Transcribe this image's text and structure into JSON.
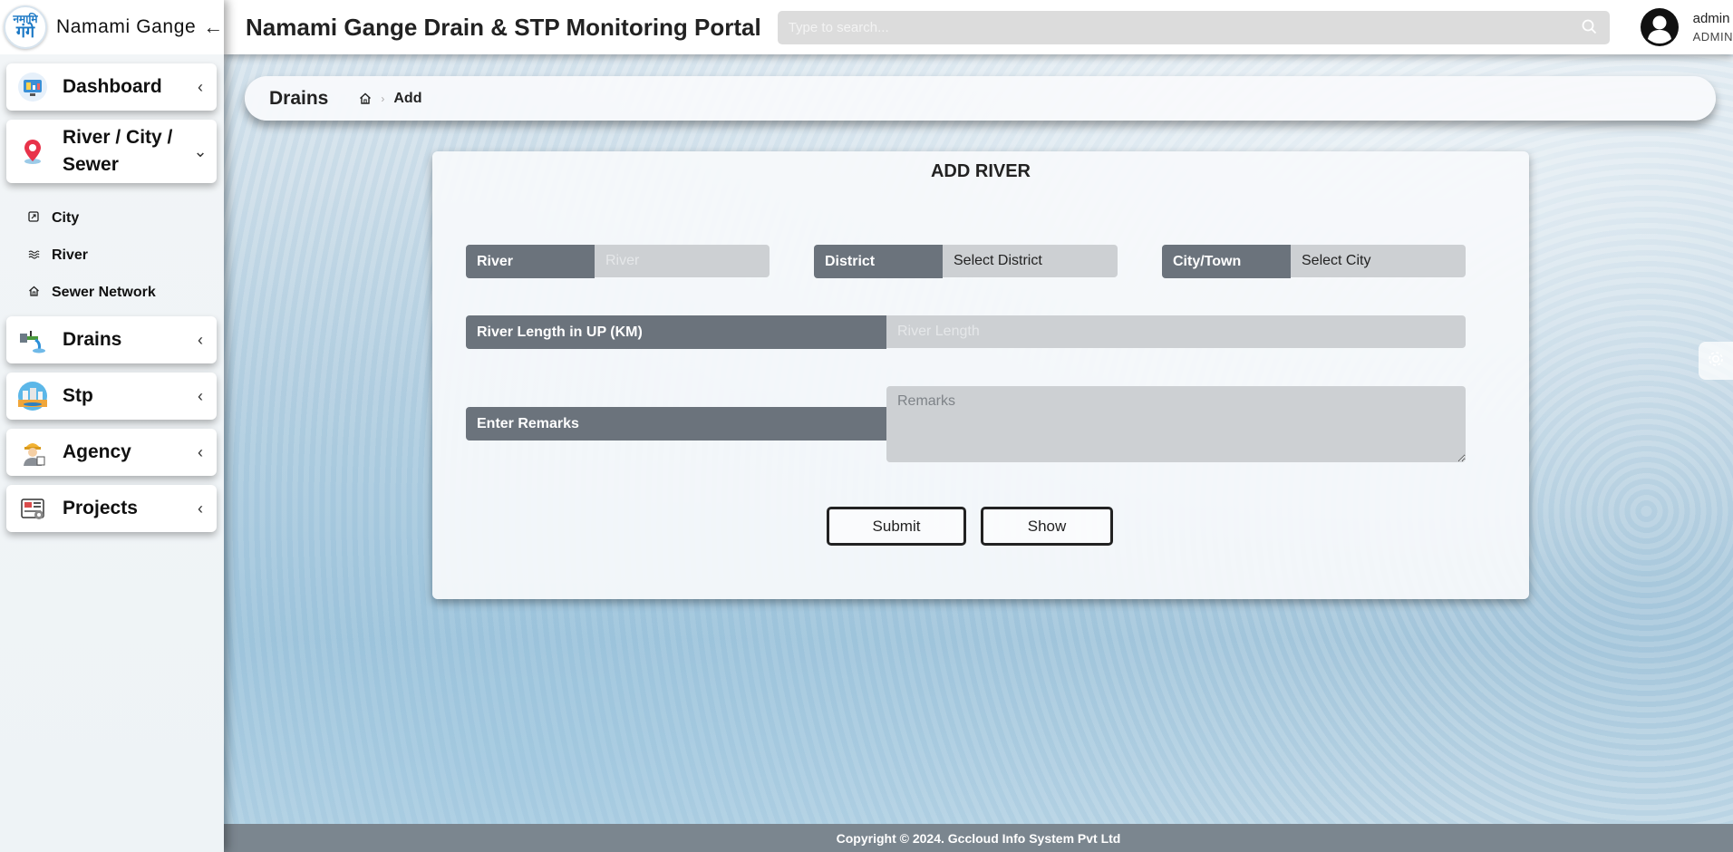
{
  "brand": {
    "logo_line1": "नमामि",
    "logo_line2": "गंगे",
    "name": "Namami Gange",
    "back_icon": "arrow-left-icon"
  },
  "sidebar": {
    "menus": [
      {
        "label": "Dashboard",
        "icon": "dashboard-icon"
      },
      {
        "label": "River / City / Sewer",
        "icon": "location-pin-icon"
      },
      {
        "label": "Drains",
        "icon": "drain-icon"
      },
      {
        "label": "Stp",
        "icon": "stp-icon"
      },
      {
        "label": "Agency",
        "icon": "agency-icon"
      },
      {
        "label": "Projects",
        "icon": "projects-icon"
      }
    ],
    "submenu": [
      {
        "label": "City",
        "icon": "city-icon"
      },
      {
        "label": "River",
        "icon": "waves-icon"
      },
      {
        "label": "Sewer Network",
        "icon": "home-icon"
      }
    ]
  },
  "header": {
    "title": "Namami Gange Drain & STP Monitoring Portal",
    "search_placeholder": "Type to search...",
    "user_name": "admin",
    "user_role": "ADMIN"
  },
  "breadcrumb": {
    "title": "Drains",
    "current": "Add"
  },
  "form": {
    "title": "ADD RIVER",
    "river_label": "River",
    "river_placeholder": "River",
    "district_label": "District",
    "district_value": "Select District",
    "city_label": "City/Town",
    "city_value": "Select City",
    "length_label": "River Length in UP (KM)",
    "length_placeholder": "River Length",
    "remarks_label": "Enter Remarks",
    "remarks_placeholder": "Remarks",
    "submit_label": "Submit",
    "show_label": "Show"
  },
  "footer": {
    "copyright": "Copyright © 2024. Gccloud Info System Pvt Ltd"
  },
  "colors": {
    "label_bg": "#6b737c",
    "input_bg": "#cdd0d3",
    "footer_bg": "#7b868f"
  }
}
